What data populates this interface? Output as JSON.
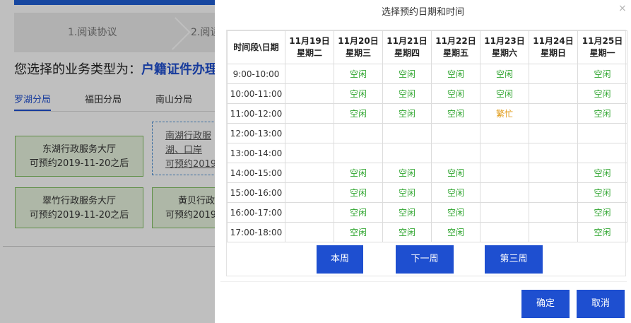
{
  "background": {
    "steps": [
      "1.阅读协议",
      "2.阅读"
    ],
    "heading_prefix": "您选择的业务类型为：",
    "heading_value": "户籍证件办理",
    "tabs": [
      "罗湖分局",
      "福田分局",
      "南山分局"
    ],
    "cards": [
      {
        "line1": "东湖行政服务大厅",
        "line2": "可预约2019-11-20之后"
      },
      {
        "line1": "南湖行政服",
        "line2": "湖、口岸",
        "line3": "可预约2019"
      },
      {
        "line1": "翠竹行政服务大厅",
        "line2": "可预约2019-11-20之后"
      },
      {
        "line1": "黄贝行政",
        "line2": "可预约2019"
      }
    ]
  },
  "modal": {
    "title": "选择预约日期和时间",
    "close_glyph": "×",
    "corner_header": "时间段\\日期",
    "columns": [
      {
        "date": "11月19日",
        "weekday": "星期二"
      },
      {
        "date": "11月20日",
        "weekday": "星期三"
      },
      {
        "date": "11月21日",
        "weekday": "星期四"
      },
      {
        "date": "11月22日",
        "weekday": "星期五"
      },
      {
        "date": "11月23日",
        "weekday": "星期六"
      },
      {
        "date": "11月24日",
        "weekday": "星期日"
      },
      {
        "date": "11月25日",
        "weekday": "星期一"
      }
    ],
    "rows": [
      {
        "slot": "9:00-10:00",
        "cells": [
          "",
          "空闲",
          "空闲",
          "空闲",
          "空闲",
          "",
          "空闲"
        ]
      },
      {
        "slot": "10:00-11:00",
        "cells": [
          "",
          "空闲",
          "空闲",
          "空闲",
          "空闲",
          "",
          "空闲"
        ]
      },
      {
        "slot": "11:00-12:00",
        "cells": [
          "",
          "空闲",
          "空闲",
          "空闲",
          "繁忙",
          "",
          "空闲"
        ]
      },
      {
        "slot": "12:00-13:00",
        "cells": [
          "",
          "",
          "",
          "",
          "",
          "",
          ""
        ]
      },
      {
        "slot": "13:00-14:00",
        "cells": [
          "",
          "",
          "",
          "",
          "",
          "",
          ""
        ]
      },
      {
        "slot": "14:00-15:00",
        "cells": [
          "",
          "空闲",
          "空闲",
          "空闲",
          "",
          "",
          "空闲"
        ]
      },
      {
        "slot": "15:00-16:00",
        "cells": [
          "",
          "空闲",
          "空闲",
          "空闲",
          "",
          "",
          "空闲"
        ]
      },
      {
        "slot": "16:00-17:00",
        "cells": [
          "",
          "空闲",
          "空闲",
          "空闲",
          "",
          "",
          "空闲"
        ]
      },
      {
        "slot": "17:00-18:00",
        "cells": [
          "",
          "空闲",
          "空闲",
          "空闲",
          "",
          "",
          "空闲"
        ]
      }
    ],
    "week_buttons": [
      "本周",
      "下一周",
      "第三周"
    ],
    "confirm_label": "确定",
    "cancel_label": "取消"
  },
  "colors": {
    "primary": "#1e4fd0",
    "free": "#2fa52f",
    "busy": "#e09a16"
  }
}
